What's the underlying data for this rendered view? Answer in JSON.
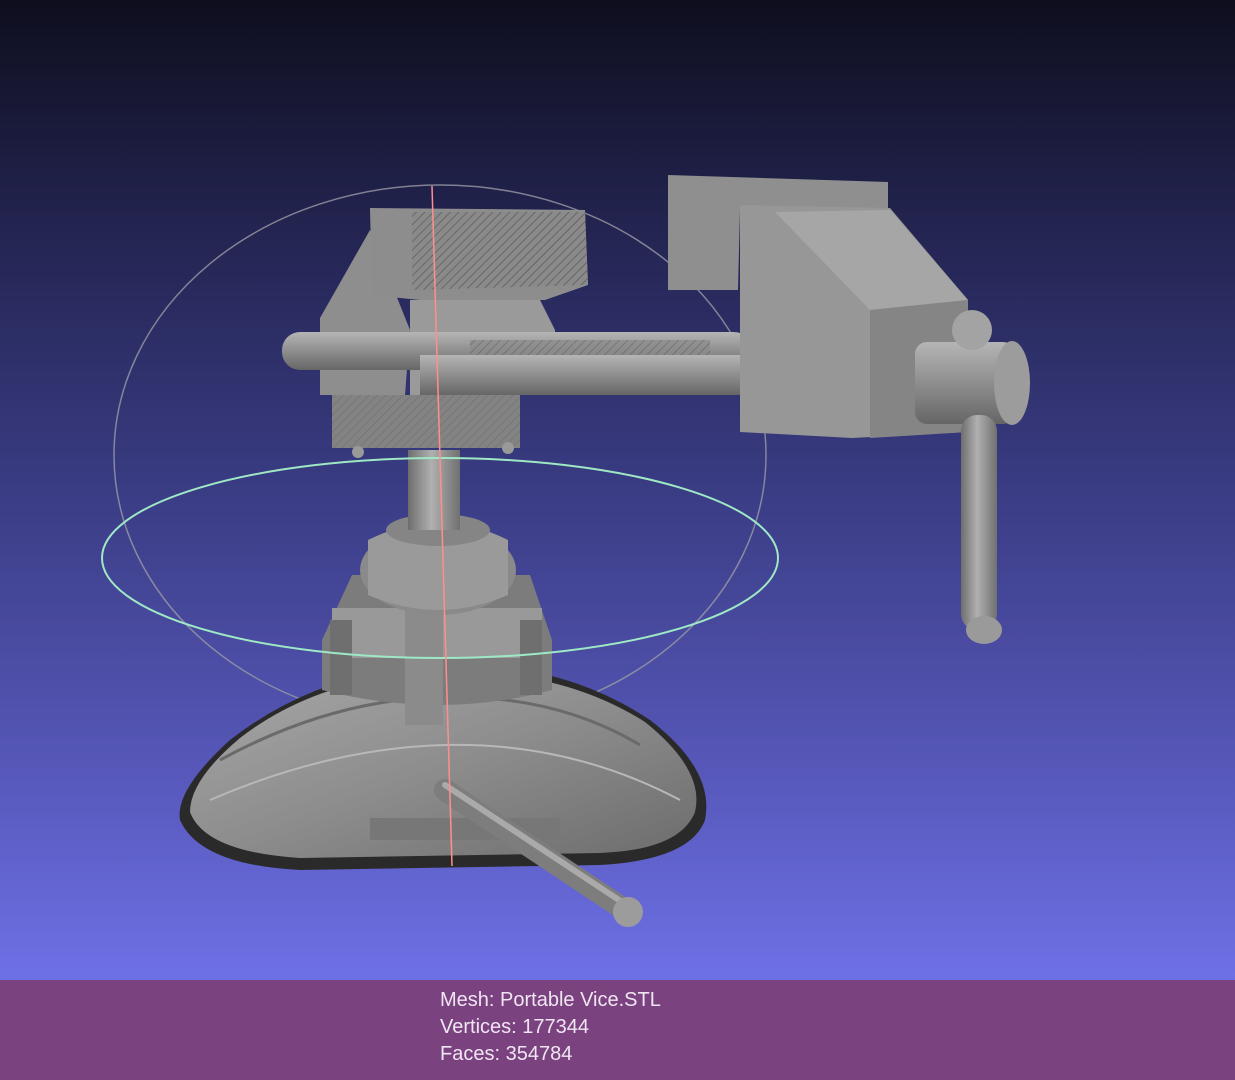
{
  "viewport": {
    "background_top": "#0e0e1e",
    "background_bottom": "#6e70e6",
    "mesh_color": "#8c8c8c",
    "trackball_colors": {
      "vertical_circle": "#9a9aa6",
      "horizontal_circle": "#9ee8c6",
      "axis_line": "#ff8f8f"
    }
  },
  "info": {
    "mesh_label": "Mesh: Portable Vice.STL",
    "vertices_label": "Vertices: 177344",
    "faces_label": "Faces: 354784",
    "bar_color": "#7b4280"
  }
}
